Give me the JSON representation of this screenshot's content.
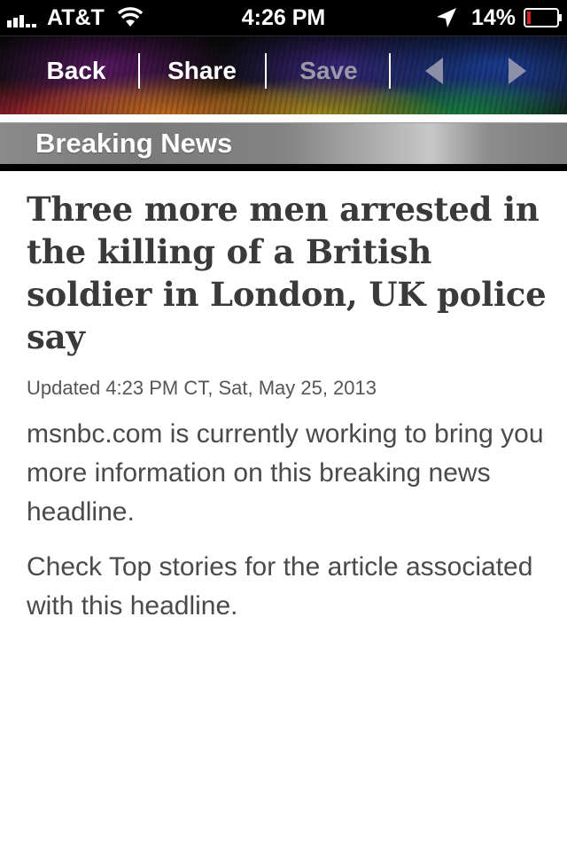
{
  "status_bar": {
    "carrier": "AT&T",
    "time": "4:26 PM",
    "battery_percent": "14%",
    "battery_level": 0.14,
    "icons": [
      "signal-bars-icon",
      "wifi-icon",
      "location-arrow-icon",
      "battery-icon"
    ]
  },
  "toolbar": {
    "back_label": "Back",
    "share_label": "Share",
    "save_label": "Save",
    "prev_icon": "triangle-left-icon",
    "next_icon": "triangle-right-icon"
  },
  "section": {
    "title": "Breaking News"
  },
  "article": {
    "headline": "Three more men arrested in the killing of a British soldier in London, UK police say",
    "updated": "Updated 4:23 PM CT, Sat, May 25, 2013",
    "paragraphs": [
      "msnbc.com is currently working to bring you more information on this breaking news headline.",
      "Check Top stories for the article associated with this headline."
    ]
  },
  "colors": {
    "status_bar_bg": "#000000",
    "section_header_bg": "#8a8a8a",
    "battery_low": "#d21f1f",
    "article_text": "#3c3c3c",
    "disabled_text": "#9a9aa8"
  }
}
